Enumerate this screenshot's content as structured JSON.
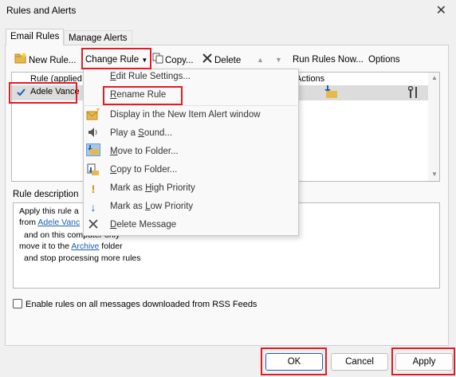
{
  "window": {
    "title": "Rules and Alerts"
  },
  "tabs": [
    {
      "label": "Email Rules"
    },
    {
      "label": "Manage Alerts"
    }
  ],
  "toolbar": {
    "new_rule": "New Rule...",
    "change_rule": "Change Rule",
    "copy": "Copy...",
    "delete": "Delete",
    "run_rules_now": "Run Rules Now...",
    "options": "Options"
  },
  "rules_list": {
    "columns": [
      "Rule (applied",
      "Actions"
    ],
    "rows": [
      {
        "name": "Adele Vance",
        "checked": true
      }
    ]
  },
  "change_rule_menu": {
    "items": [
      {
        "label": "Edit Rule Settings...",
        "icon": "none"
      },
      {
        "label": "Rename Rule",
        "icon": "none"
      },
      {
        "label": "Display in the New Item Alert window",
        "icon": "alert-envelope-icon"
      },
      {
        "label": "Play a Sound...",
        "icon": "speaker-icon"
      },
      {
        "label": "Move to Folder...",
        "icon": "move-folder-icon"
      },
      {
        "label": "Copy to Folder...",
        "icon": "copy-folder-icon"
      },
      {
        "label": "Mark as High Priority",
        "icon": "exclamation-icon"
      },
      {
        "label": "Mark as Low Priority",
        "icon": "down-arrow-icon"
      },
      {
        "label": "Delete Message",
        "icon": "x-icon"
      }
    ]
  },
  "rule_description": {
    "label": "Rule description",
    "line1": "Apply this rule a",
    "line2_prefix": "from ",
    "line2_link": "Adele Vanc",
    "line3": "and on this computer only",
    "line4_prefix": "move it to the ",
    "line4_link": "Archive",
    "line4_suffix": " folder",
    "line5": "and stop processing more rules"
  },
  "rss_checkbox": {
    "label": "Enable rules on all messages downloaded from RSS Feeds",
    "checked": false
  },
  "buttons": {
    "ok": "OK",
    "cancel": "Cancel",
    "apply": "Apply"
  },
  "colors": {
    "highlight": "#e41b23",
    "link": "#1a5fb4",
    "folder": "#e8b84a",
    "check": "#1a5fb4"
  }
}
